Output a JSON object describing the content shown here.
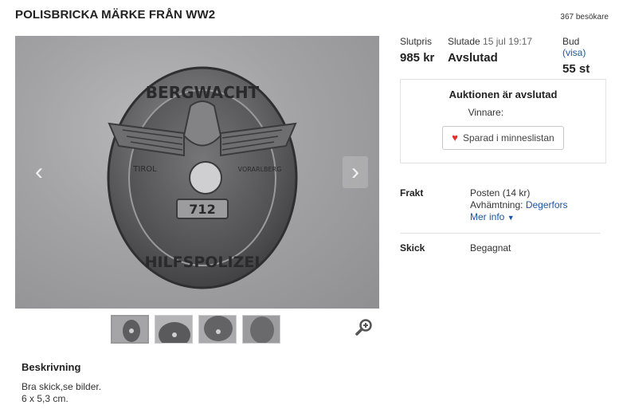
{
  "header": {
    "title": "POLISBRICKA MÄRKE FRÅN WW2",
    "visitors": "367 besökare"
  },
  "gallery": {
    "prev_label": "‹",
    "next_label": "›",
    "badge_top_text": "BERGWACHT",
    "badge_bottom_text": "HILFSPOLIZEI",
    "badge_left_text": "TIROL",
    "badge_right_text": "VORARLBERG",
    "badge_number": "712"
  },
  "auction": {
    "price_label": "Slutpris",
    "price_value": "985 kr",
    "ended_label": "Slutade",
    "ended_date": "15 jul 19:17",
    "ended_value": "Avslutad",
    "bids_label": "Bud",
    "bids_link": "(visa)",
    "bids_value": "55 st"
  },
  "status_box": {
    "heading": "Auktionen är avslutad",
    "winner_label": "Vinnare:",
    "save_button": "Sparad i minneslistan"
  },
  "shipping": {
    "label": "Frakt",
    "line1": "Posten (14 kr)",
    "pickup_label": "Avhämtning:",
    "pickup_place": "Degerfors",
    "more": "Mer info",
    "more_icon": "▼"
  },
  "condition": {
    "label": "Skick",
    "value": "Begagnat"
  },
  "description": {
    "title": "Beskrivning",
    "line1": "Bra skick,se bilder.",
    "line2": "6 x 5,3 cm."
  },
  "colors": {
    "link": "#1a55a6",
    "heart": "#e0312e"
  }
}
